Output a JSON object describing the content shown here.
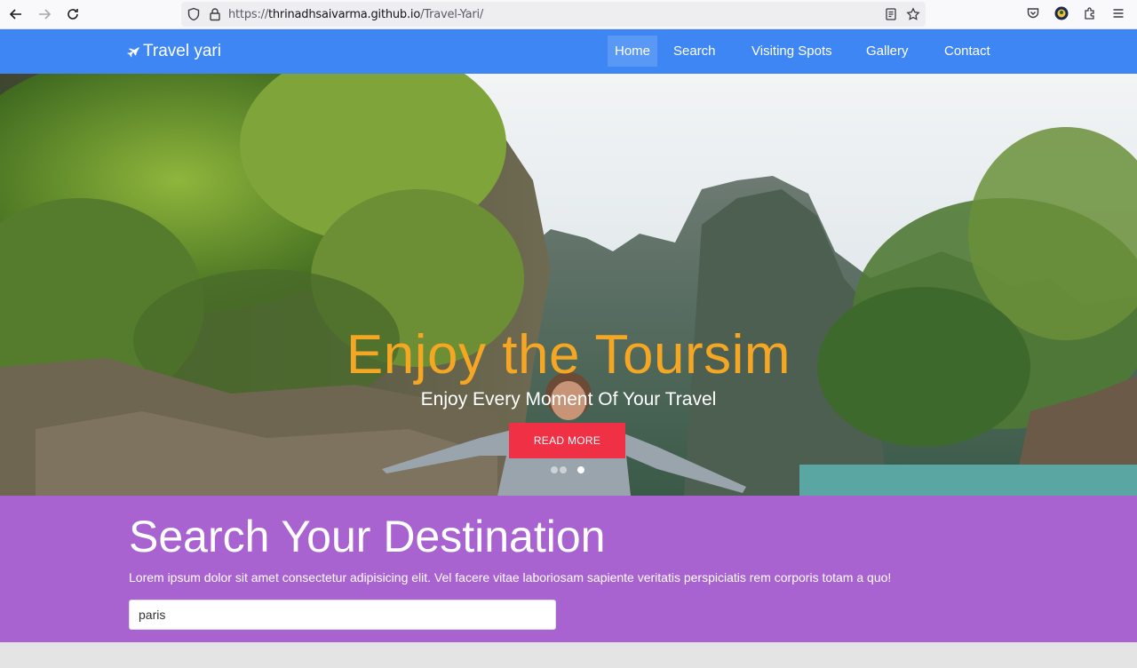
{
  "browser": {
    "url_prefix": "https://",
    "url_host": "thrinadhsaivarma.github.io",
    "url_path": "/Travel-Yari/"
  },
  "navbar": {
    "brand": "Travel yari",
    "items": [
      {
        "label": "Home",
        "active": true
      },
      {
        "label": "Search",
        "active": false
      },
      {
        "label": "Visiting Spots",
        "active": false
      },
      {
        "label": "Gallery",
        "active": false
      },
      {
        "label": "Contact",
        "active": false
      }
    ]
  },
  "hero": {
    "title": "Enjoy the Toursim",
    "subtitle": "Enjoy Every Moment Of Your Travel",
    "button": "READ MORE",
    "slide_count": 3,
    "active_slide": 3
  },
  "search": {
    "title": "Search Your Destination",
    "description": "Lorem ipsum dolor sit amet consectetur adipisicing elit. Vel facere vitae laboriosam sapiente veritatis perspiciatis rem corporis totam a quo!",
    "input_value": "paris"
  },
  "colors": {
    "navbar": "#3f86f5",
    "hero_title": "#f5a623",
    "button": "#f03045",
    "search_bg": "#a963d1"
  }
}
